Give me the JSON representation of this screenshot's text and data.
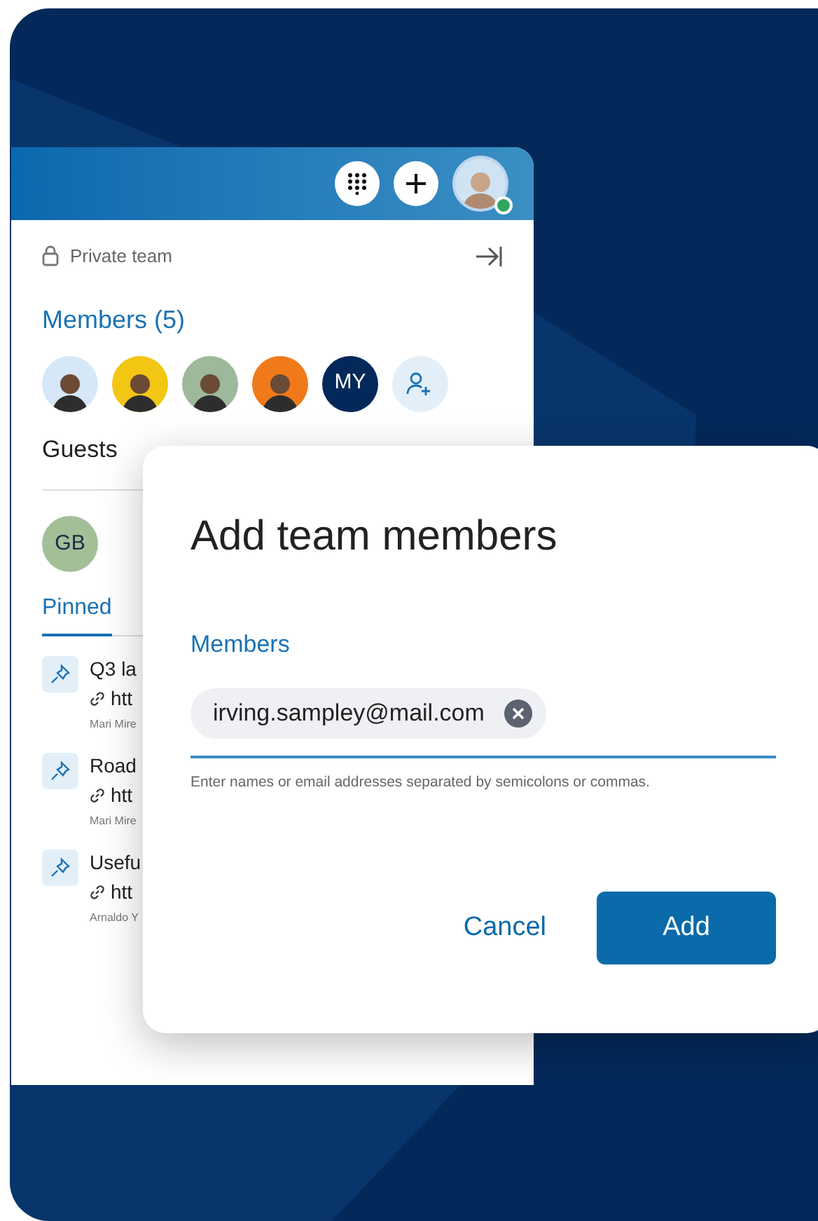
{
  "header": {
    "user_online": true
  },
  "panel": {
    "privacy": "Private team",
    "members_heading": "Members (5)",
    "members": [
      {
        "kind": "photo"
      },
      {
        "kind": "photo"
      },
      {
        "kind": "photo"
      },
      {
        "kind": "photo"
      },
      {
        "kind": "initials",
        "text": "MY"
      },
      {
        "kind": "add"
      }
    ],
    "guests_heading": "Guests",
    "guests": [
      {
        "kind": "initials",
        "text": "GB"
      }
    ],
    "tabs": [
      {
        "label": "Pinned",
        "selected": true
      }
    ],
    "pinned": [
      {
        "title": "Q3 la",
        "link": "htt",
        "author": "Mari Mire"
      },
      {
        "title": "Road",
        "link": "htt",
        "author": "Mari Mire"
      },
      {
        "title": "Usefu",
        "link": "htt",
        "author": "Arnaldo Y"
      }
    ]
  },
  "dialog": {
    "title": "Add team members",
    "field_label": "Members",
    "chips": [
      "irving.sampley@mail.com"
    ],
    "hint": "Enter names or email addresses separated by semicolons or commas.",
    "buttons": [
      {
        "label": "Cancel",
        "kind": "secondary"
      },
      {
        "label": "Add",
        "kind": "primary"
      }
    ]
  }
}
